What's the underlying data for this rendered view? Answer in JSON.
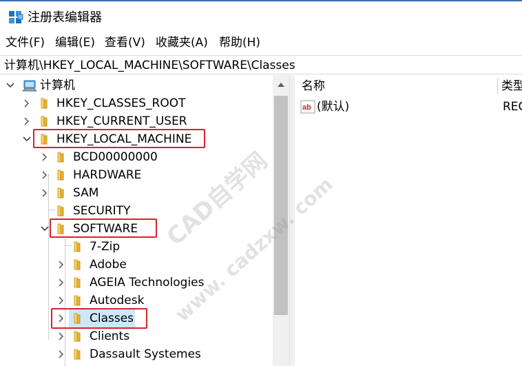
{
  "window": {
    "title": "注册表编辑器"
  },
  "menu": [
    "文件(F)",
    "编辑(E)",
    "查看(V)",
    "收藏夹(A)",
    "帮助(H)"
  ],
  "address": "计算机\\HKEY_LOCAL_MACHINE\\SOFTWARE\\Classes",
  "tree": {
    "root": "计算机",
    "hives": [
      "HKEY_CLASSES_ROOT",
      "HKEY_CURRENT_USER",
      "HKEY_LOCAL_MACHINE"
    ],
    "hklm_children": [
      "BCD00000000",
      "HARDWARE",
      "SAM",
      "SECURITY",
      "SOFTWARE"
    ],
    "software_children": [
      "7-Zip",
      "Adobe",
      "AGEIA Technologies",
      "Autodesk",
      "Classes",
      "Clients",
      "Dassault Systemes"
    ],
    "selected": "Classes"
  },
  "list": {
    "columns": [
      "名称",
      "类型"
    ],
    "rows": [
      {
        "name": "(默认)",
        "type": "REG"
      }
    ]
  },
  "watermark": {
    "line1": "CAD自学网",
    "line2": "www. cadzxw. com"
  },
  "colors": {
    "highlight": "#d9222a",
    "selection": "#cce8ff",
    "folder": "#e9b33a"
  },
  "icons": [
    "registry-editor-icon",
    "computer-icon",
    "folder-icon",
    "string-value-icon"
  ]
}
